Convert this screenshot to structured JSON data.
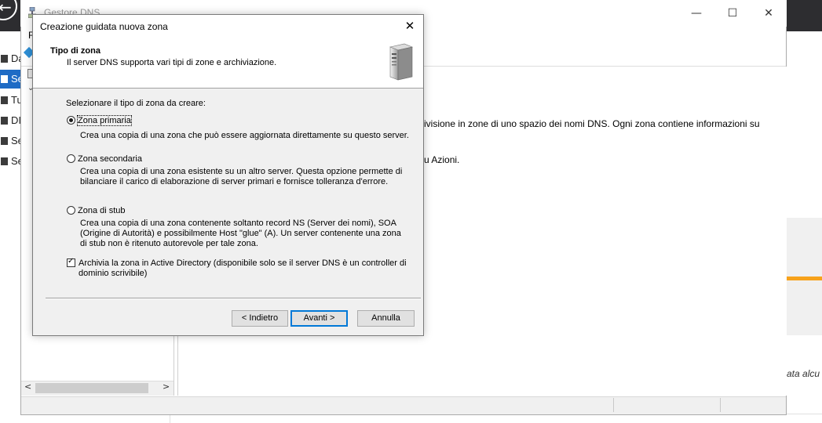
{
  "background_window": {
    "title": "Gestore DNS",
    "menu_first_item": "F",
    "nav_items": [
      "Da",
      "Se",
      "Tu",
      "DI",
      "Se",
      "Se"
    ],
    "content_line1": "ivisione in zone di uno spazio dei nomi DNS. Ogni zona contiene informazioni su",
    "content_line2": "u Azioni.",
    "right_italic": "ata alcu"
  },
  "wizard": {
    "title": "Creazione guidata nuova zona",
    "close_glyph": "✕",
    "header_title": "Tipo di zona",
    "header_subtitle": "Il server DNS supporta vari tipi di zone e archiviazione.",
    "prompt": "Selezionare il tipo di zona da creare:",
    "options": [
      {
        "label": "Zona primaria",
        "selected": true,
        "description": "Crea una copia di una zona che può essere aggiornata direttamente su questo server."
      },
      {
        "label": "Zona secondaria",
        "selected": false,
        "description": "Crea una copia di una zona esistente su un altro server. Questa opzione permette di bilanciare il carico di elaborazione di server primari e fornisce tolleranza d'errore."
      },
      {
        "label": "Zona di stub",
        "selected": false,
        "description": "Crea una copia di una zona contenente soltanto record NS (Server dei nomi), SOA (Origine di Autorità) e possibilmente Host \"glue\" (A). Un server contenente una zona di stub non è ritenuto autorevole per tale zona."
      }
    ],
    "ad_checkbox": {
      "label": "Archivia la zona in Active Directory (disponibile solo se il server DNS è un controller di dominio scrivibile)",
      "checked": true
    },
    "buttons": {
      "back": "< Indietro",
      "next": "Avanti >",
      "cancel": "Annulla"
    }
  },
  "window_controls": {
    "minimize": "—",
    "maximize": "☐",
    "close": "✕"
  },
  "colors": {
    "accent": "#0078d7",
    "nav_selected": "#1e6bc5",
    "topbar": "#2d2d30",
    "orange_bar": "#f7a21b"
  }
}
